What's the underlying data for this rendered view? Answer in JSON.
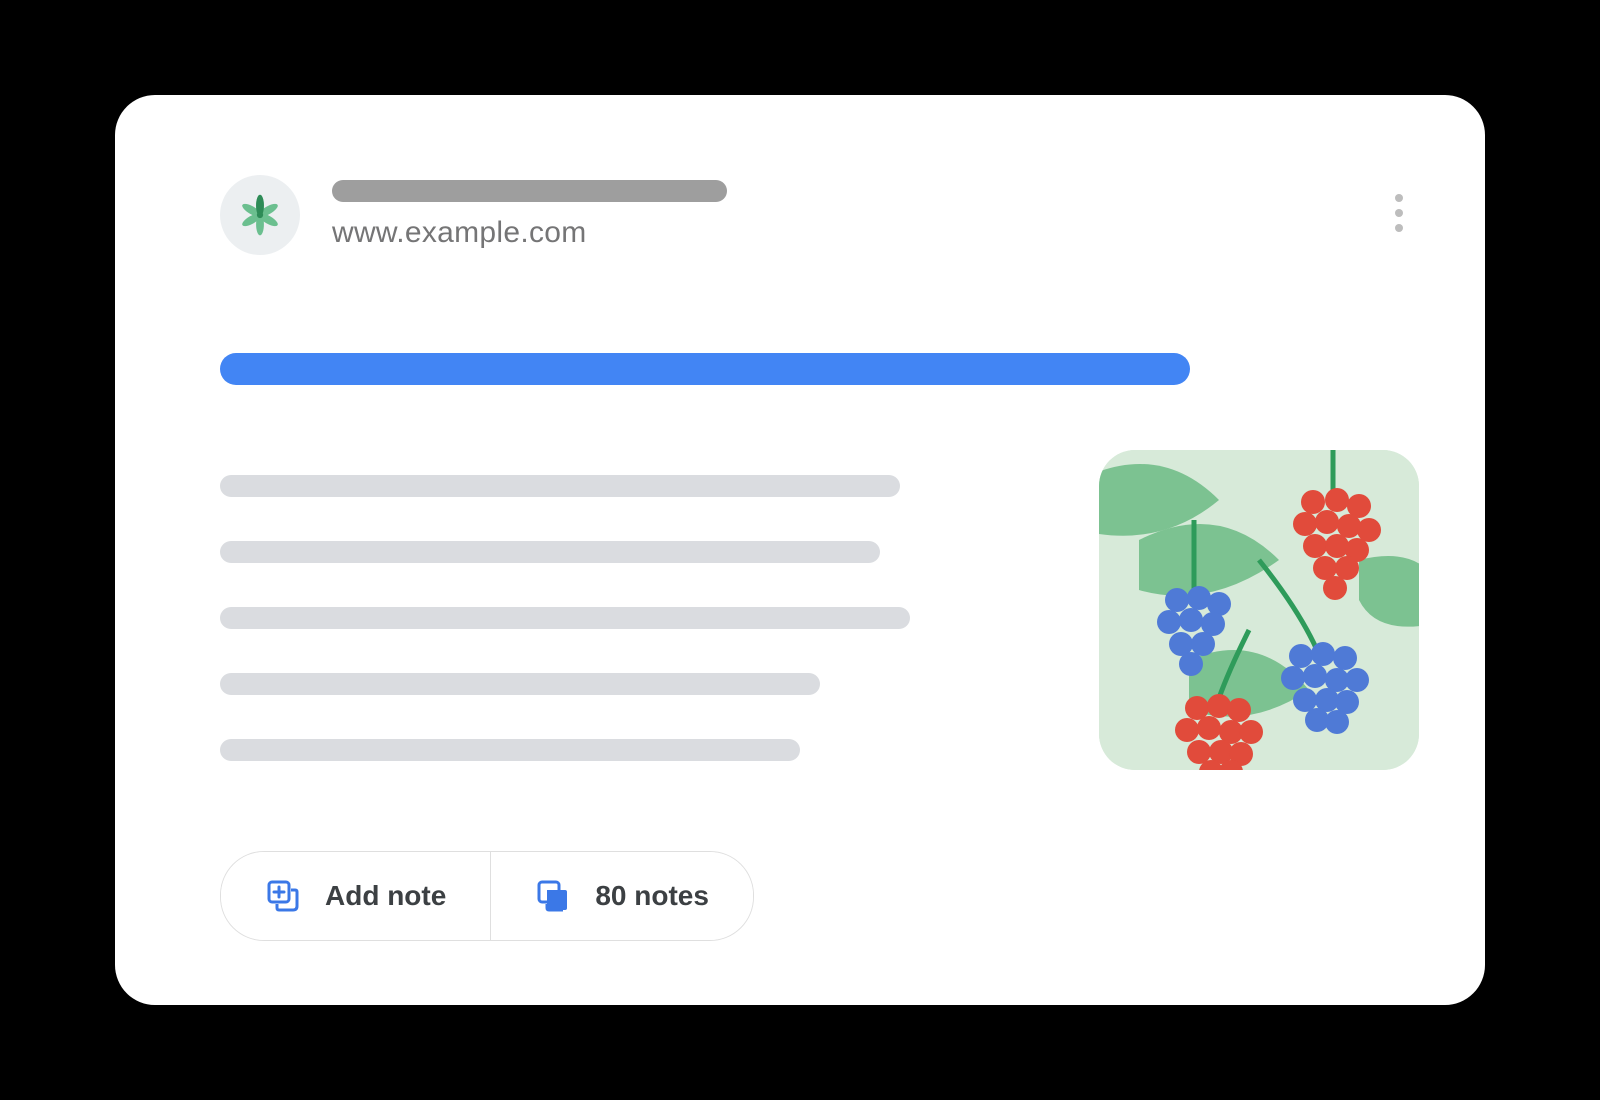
{
  "header": {
    "url": "www.example.com"
  },
  "actions": {
    "add_note_label": "Add note",
    "notes_count_label": "80 notes"
  }
}
